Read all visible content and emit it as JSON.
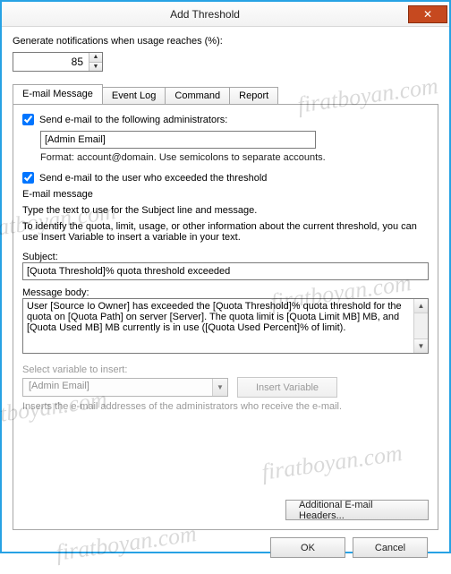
{
  "window": {
    "title": "Add Threshold"
  },
  "usage": {
    "label": "Generate notifications when usage reaches (%):",
    "value": "85"
  },
  "tabs": {
    "email": "E-mail Message",
    "eventlog": "Event Log",
    "command": "Command",
    "report": "Report"
  },
  "email": {
    "send_admin_label": "Send e-mail to the following administrators:",
    "admin_email": "[Admin Email]",
    "format_hint": "Format: account@domain. Use semicolons to separate accounts.",
    "send_user_label": "Send e-mail to the user who exceeded the threshold",
    "section_label": "E-mail message",
    "type_text_hint": "Type the text to use for the Subject line and message.",
    "identify_hint": "To identify the quota, limit, usage, or other information about the current threshold, you can use Insert Variable to insert a variable in your text.",
    "subject_label": "Subject:",
    "subject_value": "[Quota Threshold]% quota threshold exceeded",
    "body_label": "Message body:",
    "body_value": "User [Source Io Owner] has exceeded the [Quota Threshold]% quota threshold for the quota on [Quota Path] on server [Server]. The quota limit is [Quota Limit MB] MB, and [Quota Used MB] MB currently is in use ([Quota Used Percent]% of limit).",
    "select_var_label": "Select variable to insert:",
    "var_selected": "[Admin Email]",
    "insert_var_btn": "Insert Variable",
    "var_footnote": "Inserts the e-mail addresses of the administrators who receive the e-mail.",
    "additional_headers_btn": "Additional E-mail Headers..."
  },
  "buttons": {
    "ok": "OK",
    "cancel": "Cancel"
  },
  "watermark": "firatboyan.com"
}
